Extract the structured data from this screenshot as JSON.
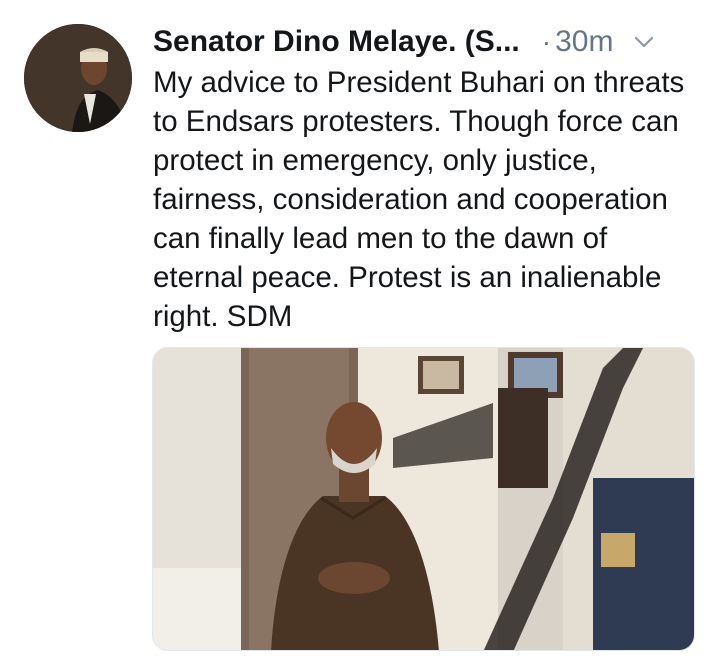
{
  "tweet": {
    "author_name": "Senator Dino Melaye. (S...",
    "separator": "·",
    "timestamp": "30m",
    "text": "My advice to President Buhari on threats to Endsars protesters. Though force can protect in emergency, only justice, fairness, consideration and cooperation can finally lead men to the dawn of eternal peace. Protest is an inalienable right. SDM",
    "avatar_icon": "profile-photo",
    "menu_icon": "chevron-down-icon",
    "media_type": "photo"
  }
}
